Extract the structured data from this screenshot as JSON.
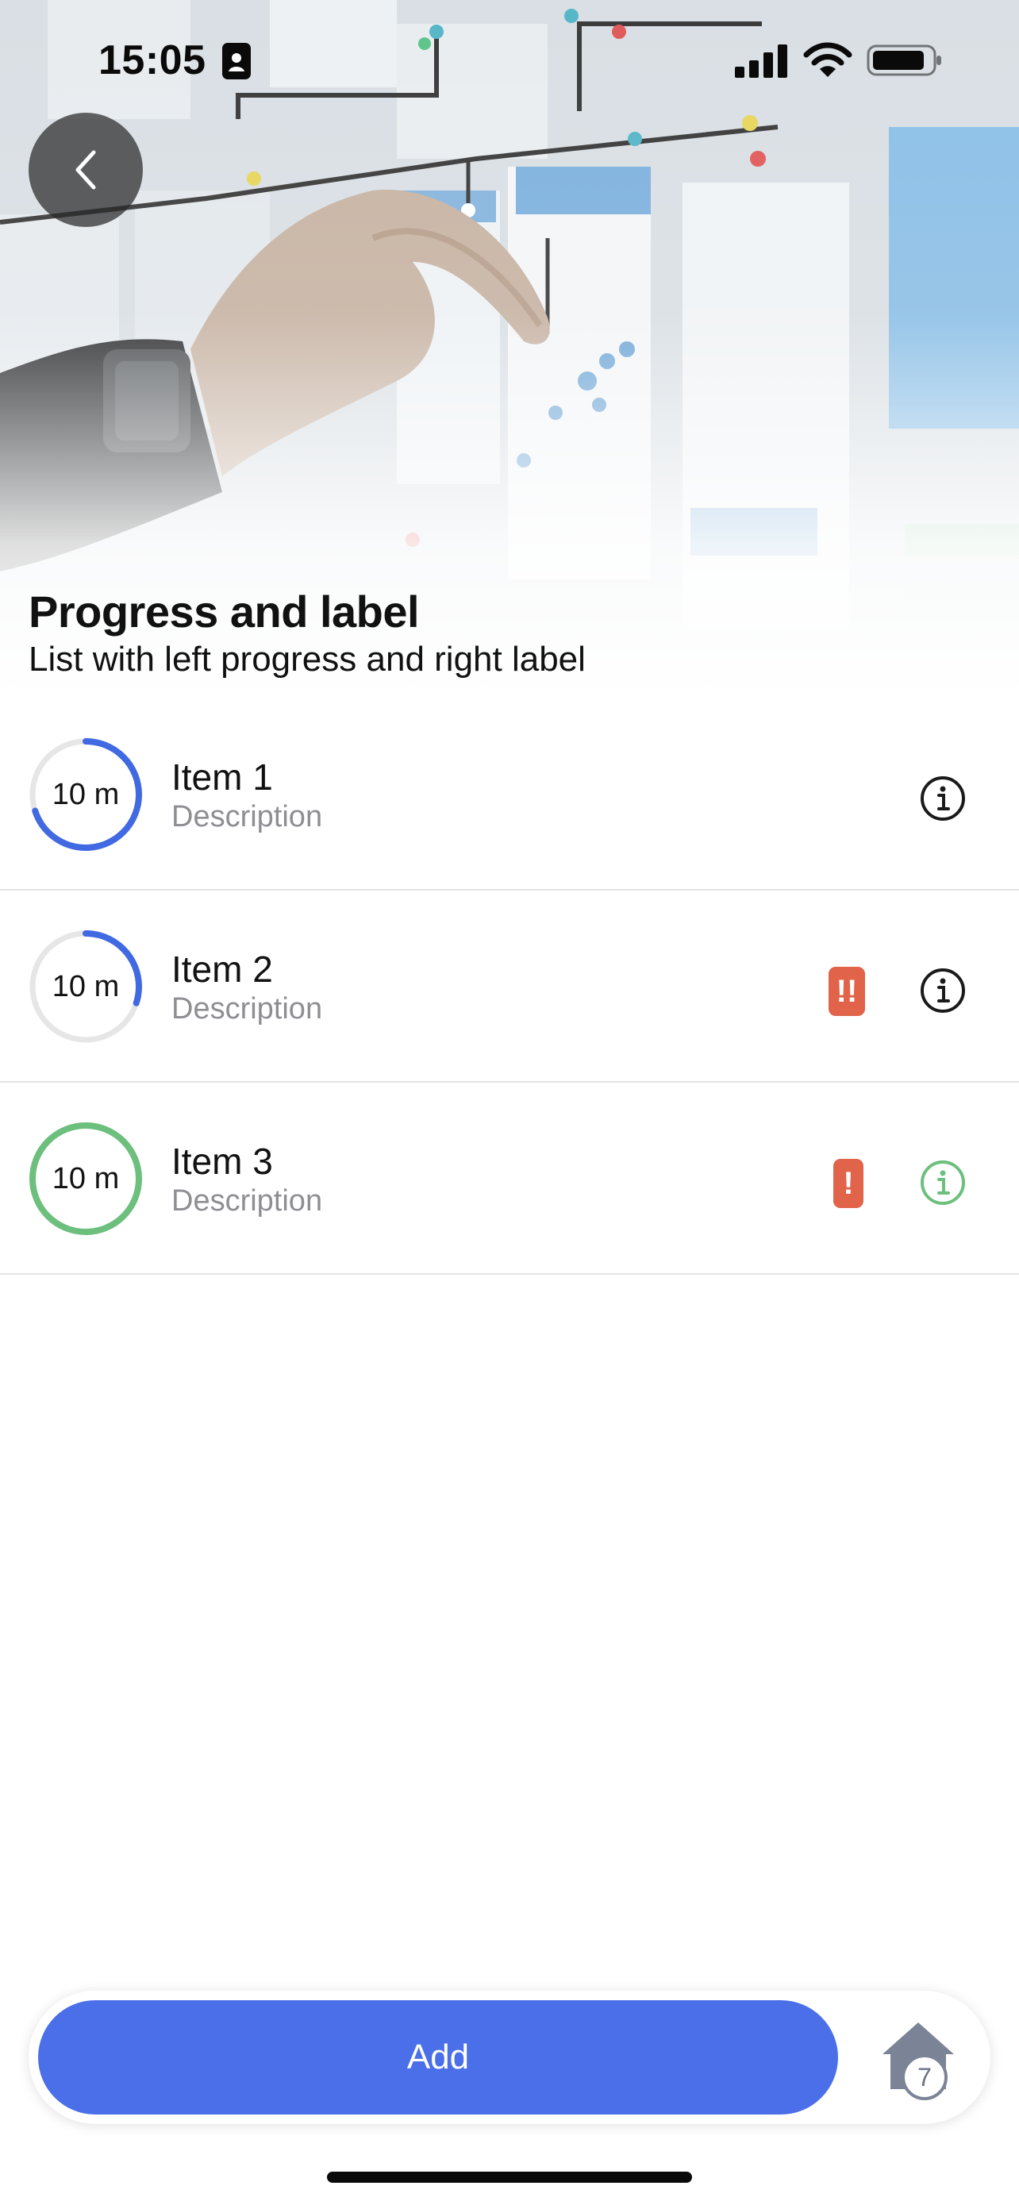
{
  "status_bar": {
    "time": "15:05"
  },
  "header": {
    "title": "Progress and label",
    "subtitle": "List with left progress and right label"
  },
  "list": {
    "items": [
      {
        "title": "Item 1",
        "description": "Description",
        "progress_label": "10 m",
        "progress": 0.7,
        "ring_color": "#4169e1",
        "badge": "",
        "info_color": "#1a1a1a"
      },
      {
        "title": "Item 2",
        "description": "Description",
        "progress_label": "10 m",
        "progress": 0.3,
        "ring_color": "#4169e1",
        "badge": "!!",
        "info_color": "#1a1a1a"
      },
      {
        "title": "Item 3",
        "description": "Description",
        "progress_label": "10 m",
        "progress": 1.0,
        "ring_color": "#6cbf7c",
        "badge": "!",
        "info_color": "#6cbf7c"
      }
    ]
  },
  "bottom_bar": {
    "add_label": "Add",
    "home_count": "7"
  },
  "colors": {
    "accent": "#4a6fe8",
    "badge": "#e0634a",
    "success": "#6cbf7c"
  }
}
